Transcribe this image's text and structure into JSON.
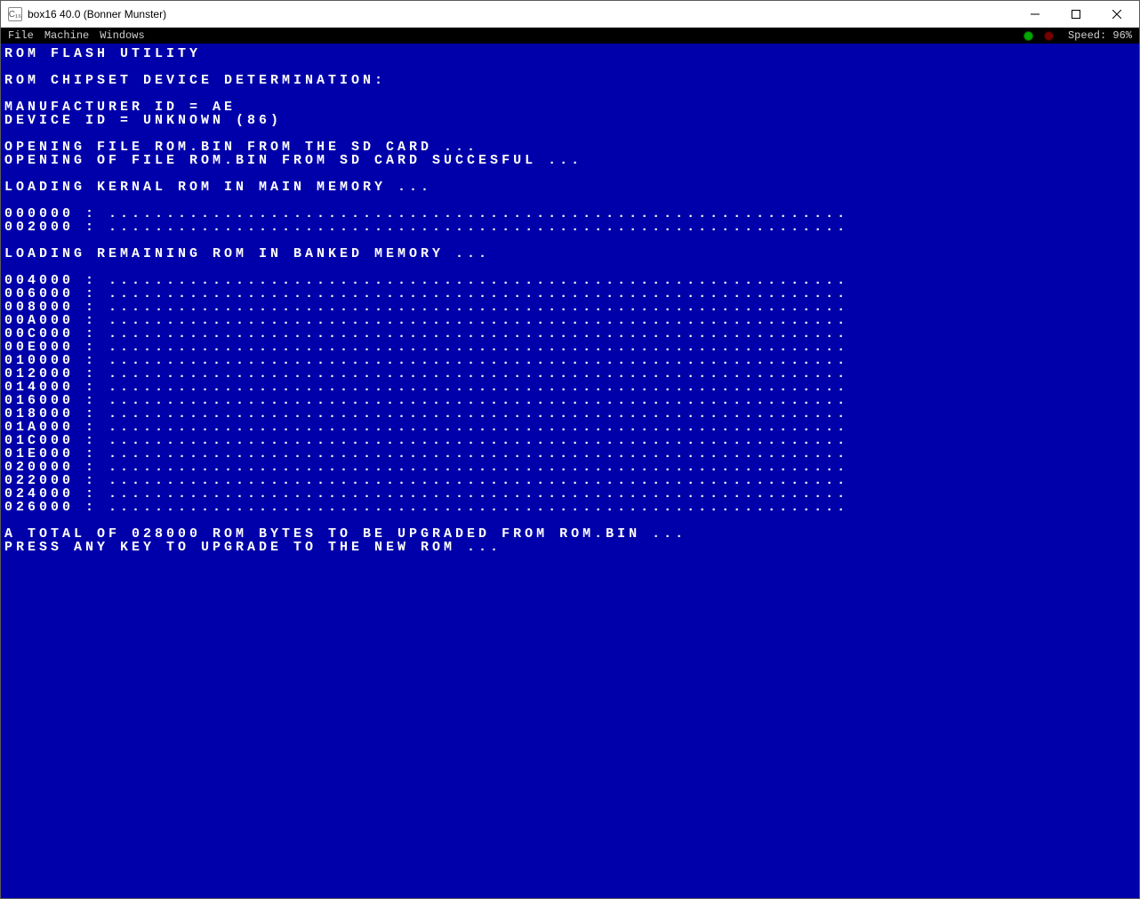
{
  "window": {
    "title": "box16 40.0 (Bonner Munster)"
  },
  "menubar": {
    "items": [
      "File",
      "Machine",
      "Windows"
    ],
    "speed_label": "Speed:",
    "speed_value": "96%"
  },
  "dots": "................................................................",
  "screen": {
    "lines": [
      "ROM FLASH UTILITY",
      "",
      "ROM CHIPSET DEVICE DETERMINATION:",
      "",
      "MANUFACTURER ID = AE",
      "DEVICE ID = UNKNOWN (86)",
      "",
      "OPENING FILE ROM.BIN FROM THE SD CARD ...",
      "OPENING OF FILE ROM.BIN FROM SD CARD SUCCESFUL ...",
      "",
      "LOADING KERNAL ROM IN MAIN MEMORY ...",
      "",
      "000000 : {DOTS}",
      "002000 : {DOTS}",
      "",
      "LOADING REMAINING ROM IN BANKED MEMORY ...",
      "",
      "004000 : {DOTS}",
      "006000 : {DOTS}",
      "008000 : {DOTS}",
      "00A000 : {DOTS}",
      "00C000 : {DOTS}",
      "00E000 : {DOTS}",
      "010000 : {DOTS}",
      "012000 : {DOTS}",
      "014000 : {DOTS}",
      "016000 : {DOTS}",
      "018000 : {DOTS}",
      "01A000 : {DOTS}",
      "01C000 : {DOTS}",
      "01E000 : {DOTS}",
      "020000 : {DOTS}",
      "022000 : {DOTS}",
      "024000 : {DOTS}",
      "026000 : {DOTS}",
      "",
      "A TOTAL OF 028000 ROM BYTES TO BE UPGRADED FROM ROM.BIN ...",
      "PRESS ANY KEY TO UPGRADE TO THE NEW ROM ..."
    ]
  }
}
